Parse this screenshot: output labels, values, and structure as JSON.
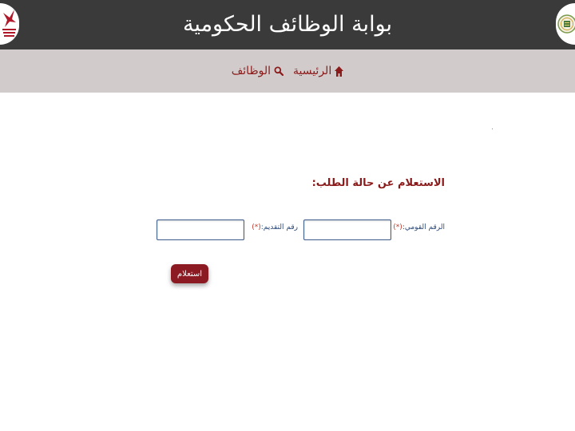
{
  "header": {
    "title": "بوابة الوظائف الحكومية",
    "background": "#3a3a3a",
    "left_logo_icon": "red-bird-logo-icon",
    "right_logo_icon": "government-seal-icon"
  },
  "nav": {
    "items": [
      {
        "label": "الرئيسية",
        "icon": "home-icon"
      },
      {
        "label": "الوظائف",
        "icon": "search-icon"
      }
    ],
    "background": "#d2cbcb",
    "link_color": "#8b1a1a"
  },
  "form": {
    "title": "الاستعلام عن حالة الطلب:",
    "fields": [
      {
        "label": "الرقم القومي:",
        "required_mark": "(*)",
        "value": ""
      },
      {
        "label": "رقم التقديم:",
        "required_mark": "(*)",
        "value": ""
      }
    ],
    "submit_label": "استعلام",
    "accent": "#8b1a22"
  }
}
